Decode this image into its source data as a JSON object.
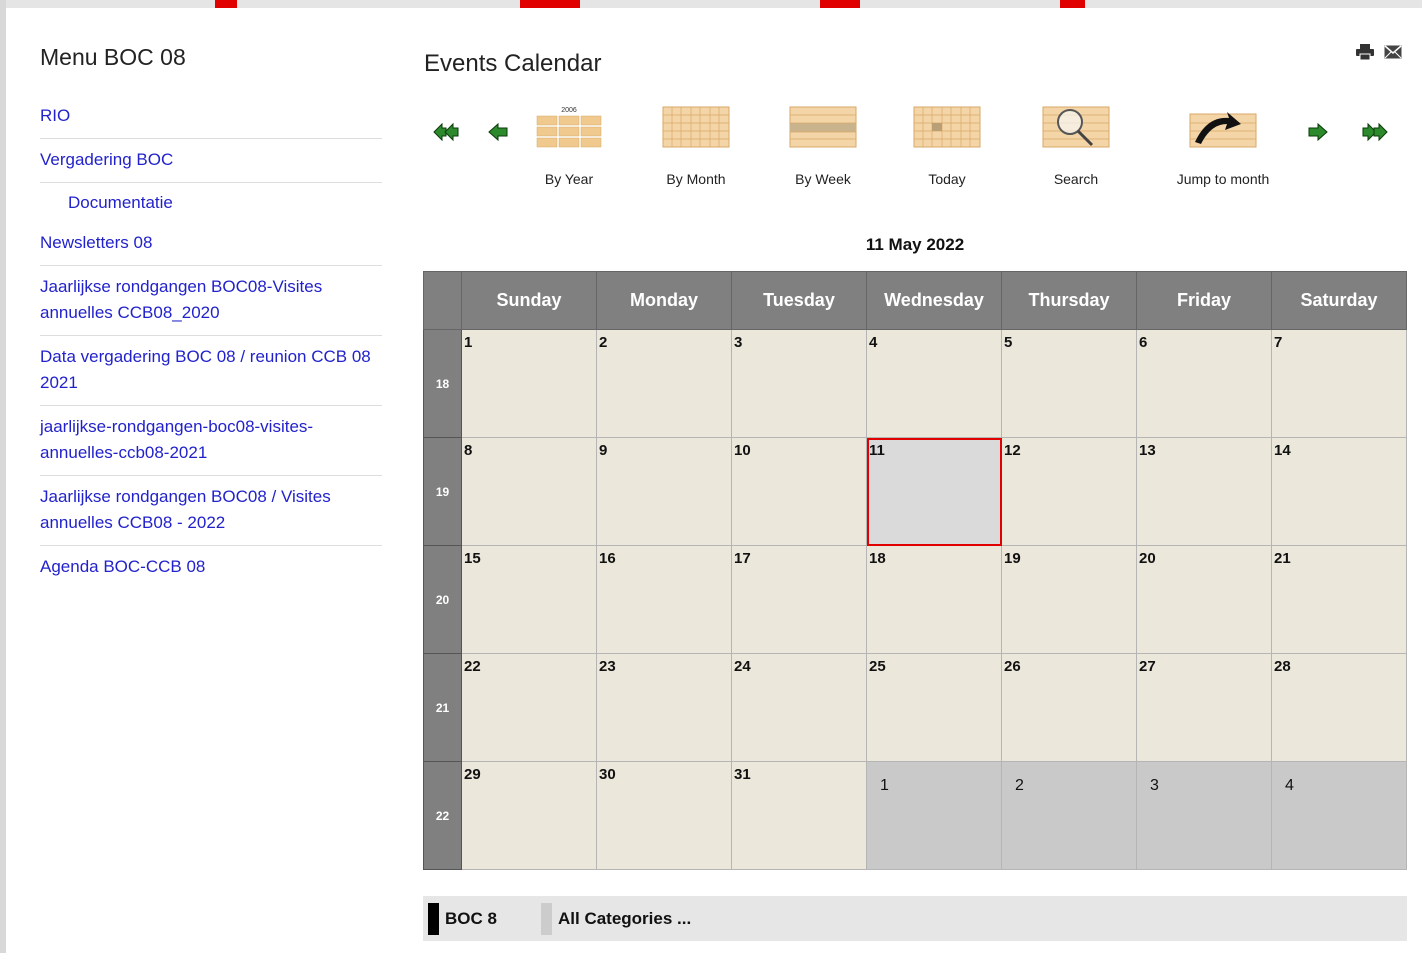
{
  "sidebar": {
    "title": "Menu BOC 08",
    "items": [
      {
        "label": "RIO"
      },
      {
        "label": "Vergadering BOC"
      },
      {
        "label": "Documentatie"
      },
      {
        "label": "Newsletters 08"
      },
      {
        "label": "Jaarlijkse rondgangen BOC08-Visites annuelles CCB08_2020"
      },
      {
        "label": "Data vergadering BOC 08 / reunion CCB 08 2021"
      },
      {
        "label": "jaarlijkse-rondgangen-boc08-visites-annuelles-ccb08-2021"
      },
      {
        "label": "Jaarlijkse rondgangen BOC08 / Visites annuelles CCB08 - 2022"
      },
      {
        "label": "Agenda BOC-CCB 08"
      }
    ]
  },
  "header": {
    "title": "Events Calendar",
    "print_icon": "printer-icon",
    "email_icon": "envelope-icon"
  },
  "toolbar": {
    "by_year": "By Year",
    "by_month": "By Month",
    "by_week": "By Week",
    "today": "Today",
    "search": "Search",
    "jump": "Jump to month",
    "year_image_text": "2006"
  },
  "calendar": {
    "current_date": "11 May 2022",
    "weekdays": [
      "Sunday",
      "Monday",
      "Tuesday",
      "Wednesday",
      "Thursday",
      "Friday",
      "Saturday"
    ],
    "weeks": [
      {
        "num": "18",
        "days": [
          "1",
          "2",
          "3",
          "4",
          "5",
          "6",
          "7"
        ]
      },
      {
        "num": "19",
        "days": [
          "8",
          "9",
          "10",
          "11",
          "12",
          "13",
          "14"
        ]
      },
      {
        "num": "20",
        "days": [
          "15",
          "16",
          "17",
          "18",
          "19",
          "20",
          "21"
        ]
      },
      {
        "num": "21",
        "days": [
          "22",
          "23",
          "24",
          "25",
          "26",
          "27",
          "28"
        ]
      },
      {
        "num": "22",
        "days": [
          "29",
          "30",
          "31",
          "1",
          "2",
          "3",
          "4"
        ]
      }
    ],
    "today_day": "11"
  },
  "legend": {
    "items": [
      {
        "label": "BOC 8",
        "color": "#000000"
      },
      {
        "label": "All Categories ...",
        "color": "#cccccc"
      }
    ]
  },
  "colors": {
    "header_bg": "#808080",
    "cell_bg": "#ebe7da",
    "today_border": "#e00000",
    "link": "#2222cc",
    "arrow_green": "#2c8a2c"
  }
}
